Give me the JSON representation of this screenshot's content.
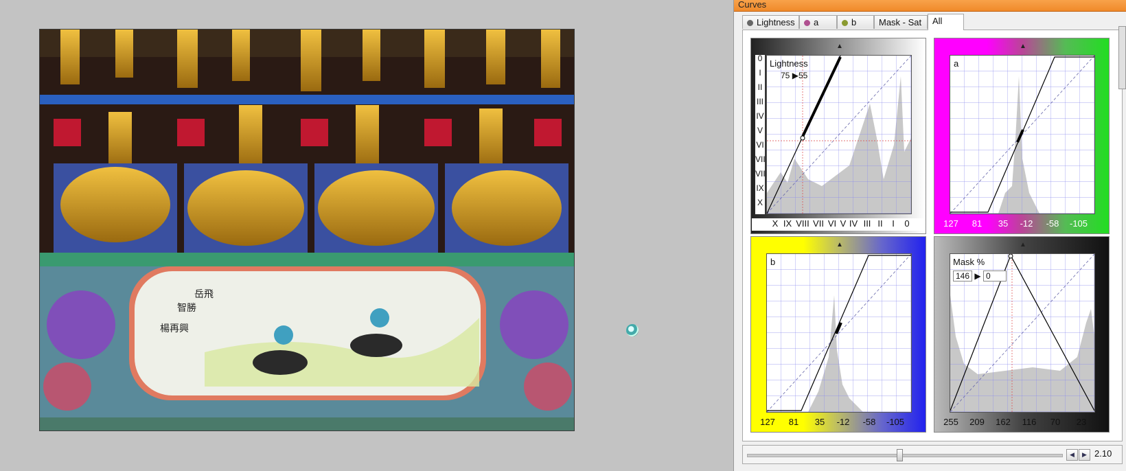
{
  "window": {
    "title": "Curves"
  },
  "tabs": [
    {
      "label": "Lightness",
      "icon": "lightness-dot-icon",
      "dot": "#666"
    },
    {
      "label": "a",
      "icon": "a-channel-dot-icon",
      "dot": "#b05090"
    },
    {
      "label": "b",
      "icon": "b-channel-dot-icon",
      "dot": "#8a9a30"
    },
    {
      "label": "Mask - Sat",
      "icon": "",
      "dot": ""
    },
    {
      "label": "All",
      "icon": "",
      "dot": ""
    }
  ],
  "active_tab": "All",
  "lightness_panel": {
    "label": "Lightness",
    "readout_in": "75",
    "readout_out": "55",
    "vertical_ticks": [
      "0",
      "I",
      "II",
      "III",
      "IV",
      "V",
      "VI",
      "VII",
      "VIII",
      "IX",
      "X"
    ],
    "bottom_ticks": [
      "X",
      "IX",
      "VIII",
      "VII",
      "VI",
      "V",
      "IV",
      "III",
      "II",
      "I",
      "0"
    ]
  },
  "a_panel": {
    "label": "a",
    "bottom_ticks": [
      "127",
      "81",
      "35",
      "-12",
      "-58",
      "-105"
    ],
    "colors": {
      "left": "#ff00ff",
      "right": "#22dd22"
    }
  },
  "b_panel": {
    "label": "b",
    "bottom_ticks": [
      "127",
      "81",
      "35",
      "-12",
      "-58",
      "-105"
    ],
    "colors": {
      "left": "#ffff00",
      "right": "#2222ee"
    }
  },
  "mask_panel": {
    "label": "Mask %",
    "readout_in": "146",
    "readout_out": "0",
    "bottom_ticks": [
      "255",
      "209",
      "162",
      "116",
      "70",
      "23"
    ]
  },
  "zoom": {
    "value": "2.10",
    "position": 0.46
  }
}
